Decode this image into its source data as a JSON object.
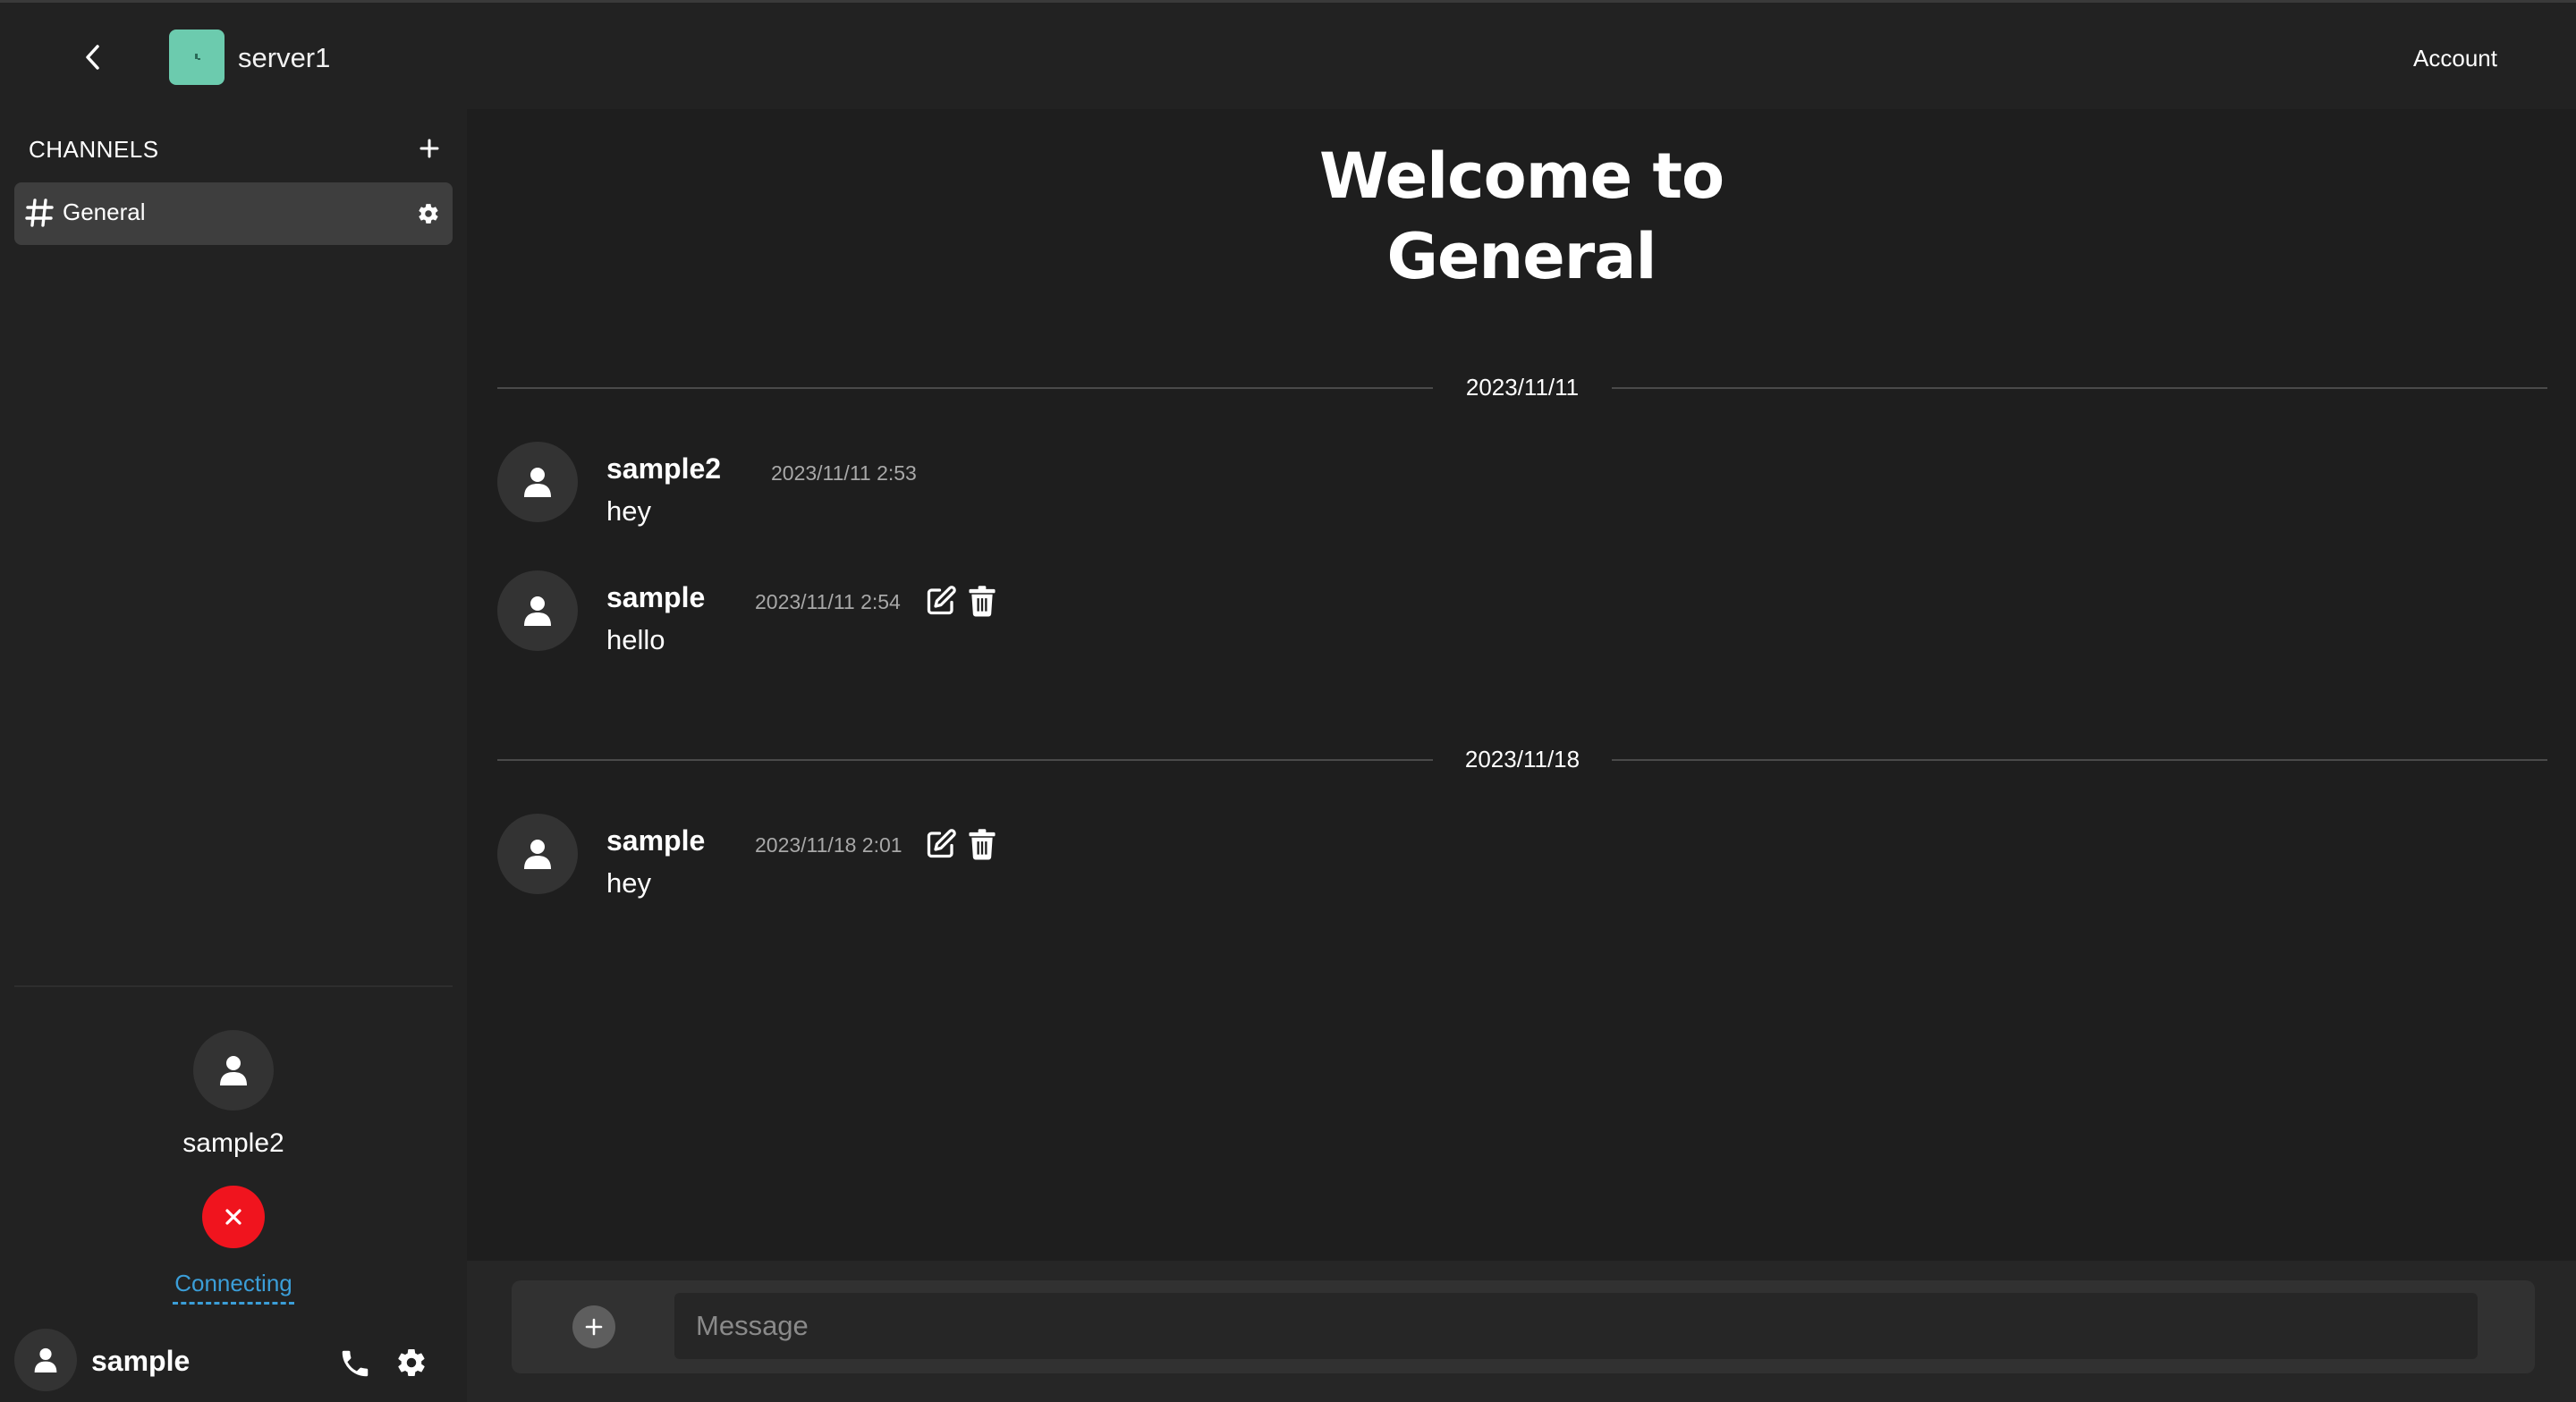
{
  "header": {
    "server_name": "server1",
    "account_label": "Account"
  },
  "sidebar": {
    "channels_header": "CHANNELS",
    "channels": [
      {
        "label": "General",
        "selected": true
      }
    ],
    "voice": {
      "participant_name": "sample2",
      "status_text": "Connecting"
    },
    "user": {
      "name": "sample"
    }
  },
  "main": {
    "welcome_line1": "Welcome to",
    "welcome_line2": "General",
    "date_groups": [
      {
        "date": "2023/11/11",
        "messages": [
          {
            "author": "sample2",
            "time": "2023/11/11 2:53",
            "text": "hey",
            "own": false
          },
          {
            "author": "sample",
            "time": "2023/11/11 2:54",
            "text": "hello",
            "own": true
          }
        ]
      },
      {
        "date": "2023/11/18",
        "messages": [
          {
            "author": "sample",
            "time": "2023/11/18 2:01",
            "text": "hey",
            "own": true
          }
        ]
      }
    ],
    "composer": {
      "placeholder": "Message"
    }
  },
  "colors": {
    "server_logo": "#6ccbae",
    "disconnect": "#f0141e",
    "connecting": "#3b9ed8",
    "background": "#1e1e1e",
    "panel": "#222222"
  },
  "icons": {
    "back": "chevron-left-icon",
    "add_channel": "plus-icon",
    "channel": "hash-icon",
    "channel_settings": "gear-icon",
    "disconnect": "close-icon",
    "call": "phone-icon",
    "user_settings": "gear-icon",
    "edit": "edit-icon",
    "delete": "trash-icon",
    "attach": "plus-icon",
    "avatar": "user-icon"
  }
}
